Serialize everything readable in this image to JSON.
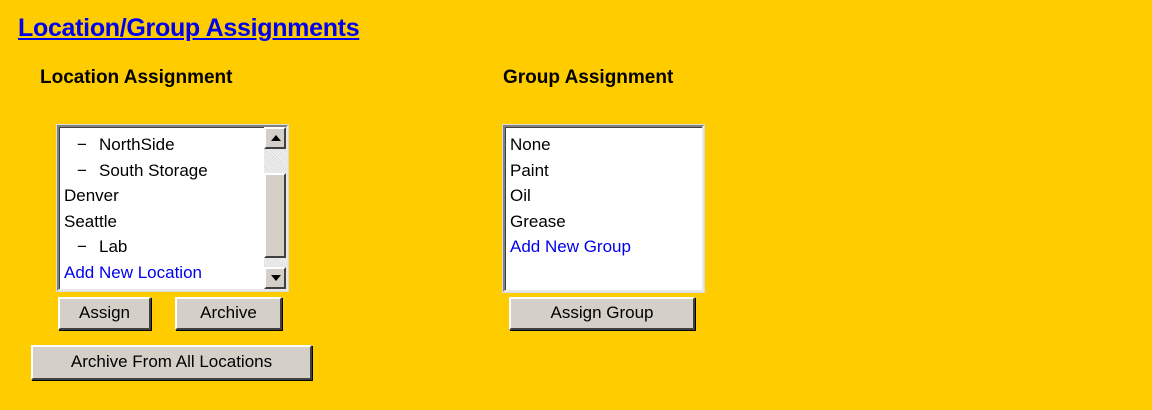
{
  "page": {
    "title": "Location/Group Assignments"
  },
  "location_assignment": {
    "heading": "Location Assignment",
    "items": [
      {
        "label": "NorthSide",
        "indent": true,
        "link": false
      },
      {
        "label": "South Storage",
        "indent": true,
        "link": false
      },
      {
        "label": "Denver",
        "indent": false,
        "link": false
      },
      {
        "label": "Seattle",
        "indent": false,
        "link": false
      },
      {
        "label": "Lab",
        "indent": true,
        "link": false
      },
      {
        "label": "Add New Location",
        "indent": false,
        "link": true
      }
    ],
    "child_prefix": "−",
    "assign_label": "Assign",
    "archive_label": "Archive",
    "archive_all_label": "Archive From All Locations"
  },
  "group_assignment": {
    "heading": "Group Assignment",
    "items": [
      {
        "label": "None",
        "link": false
      },
      {
        "label": "Paint",
        "link": false
      },
      {
        "label": "Oil",
        "link": false
      },
      {
        "label": "Grease",
        "link": false
      },
      {
        "label": "Add New Group",
        "link": true
      }
    ],
    "assign_group_label": "Assign Group"
  },
  "colors": {
    "background": "#FFCC00",
    "link": "#0000EE",
    "button_face": "#D4D0C8"
  }
}
